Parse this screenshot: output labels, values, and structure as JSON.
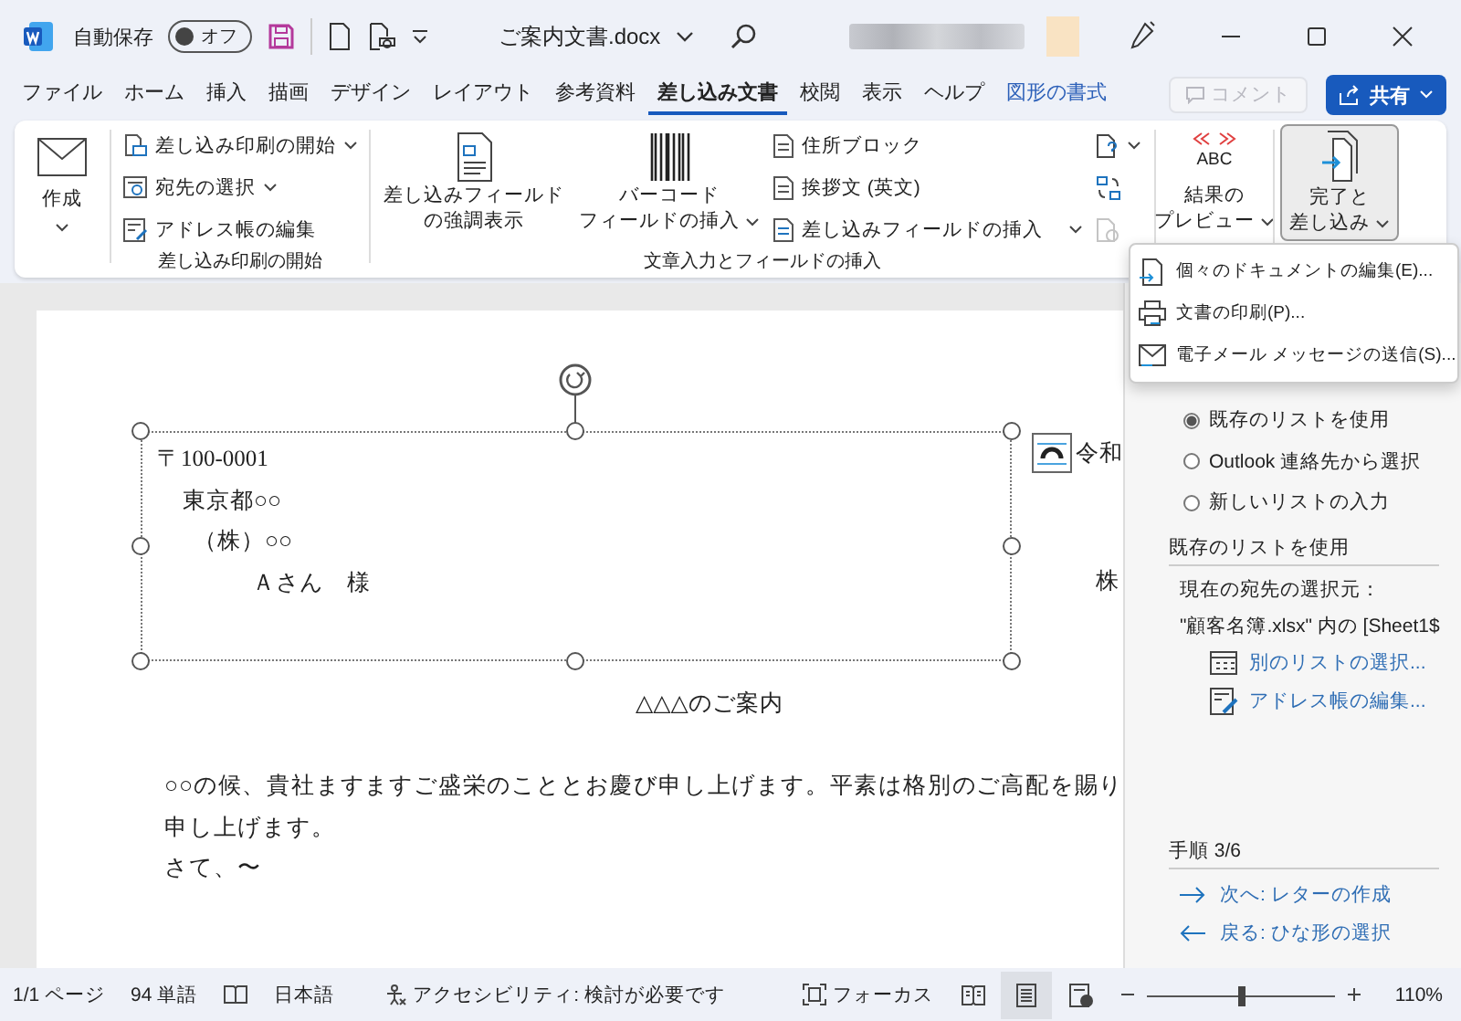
{
  "title_bar": {
    "autosave_label": "自動保存",
    "autosave": {
      "on": false,
      "label": "オフ"
    },
    "document_title": "ご案内文書.docx"
  },
  "menu_tabs": [
    {
      "label": "ファイル",
      "selected": false,
      "kind": "normal"
    },
    {
      "label": "ホーム",
      "selected": false,
      "kind": "normal"
    },
    {
      "label": "挿入",
      "selected": false,
      "kind": "normal"
    },
    {
      "label": "描画",
      "selected": false,
      "kind": "normal"
    },
    {
      "label": "デザイン",
      "selected": false,
      "kind": "normal"
    },
    {
      "label": "レイアウト",
      "selected": false,
      "kind": "normal"
    },
    {
      "label": "参考資料",
      "selected": false,
      "kind": "normal"
    },
    {
      "label": "差し込み文書",
      "selected": true,
      "kind": "normal"
    },
    {
      "label": "校閲",
      "selected": false,
      "kind": "normal"
    },
    {
      "label": "表示",
      "selected": false,
      "kind": "normal"
    },
    {
      "label": "ヘルプ",
      "selected": false,
      "kind": "normal"
    },
    {
      "label": "図形の書式",
      "selected": false,
      "kind": "contextual"
    }
  ],
  "comment_button": {
    "label": "コメント",
    "disabled": true
  },
  "share_button": {
    "label": "共有"
  },
  "ribbon": {
    "create": {
      "label": "作成",
      "dropdown": true
    },
    "start_group": {
      "items": [
        {
          "label": "差し込み印刷の開始",
          "dropdown": true
        },
        {
          "label": "宛先の選択",
          "dropdown": true
        },
        {
          "label": "アドレス帳の編集",
          "dropdown": false
        }
      ],
      "label": "差し込み印刷の開始"
    },
    "insert_group": {
      "large": [
        {
          "lines": [
            "差し込みフィールド",
            "の強調表示"
          ],
          "dropdown": false
        },
        {
          "lines": [
            "バーコード",
            "フィールドの挿入"
          ],
          "dropdown": true
        }
      ],
      "items": [
        {
          "label": "住所ブロック",
          "dropdown": false
        },
        {
          "label": "挨拶文 (英文)",
          "dropdown": false
        },
        {
          "label": "差し込みフィールドの挿入",
          "dropdown": true
        }
      ],
      "icon_buttons": [
        {
          "disabled": false,
          "dropdown": true
        },
        {
          "disabled": false,
          "dropdown": false
        },
        {
          "disabled": true,
          "dropdown": false
        }
      ],
      "label": "文章入力とフィールドの挿入"
    },
    "preview_group": {
      "icon_text": "ABC",
      "lines": [
        "結果の",
        "プレビュー"
      ],
      "dropdown": true
    },
    "finish_group": {
      "lines": [
        "完了と",
        "差し込み"
      ],
      "dropdown": true,
      "expanded": true
    }
  },
  "finish_menu": {
    "items": [
      {
        "label": "個々のドキュメントの編集(E)..."
      },
      {
        "label": "文書の印刷(P)..."
      },
      {
        "label": "電子メール メッセージの送信(S)..."
      }
    ]
  },
  "document": {
    "address_lines": [
      "〒100-0001",
      "東京都○○",
      "（株）○○",
      "Ａさん　様"
    ],
    "date_fragment": "令和",
    "right_fragment": "株",
    "heading": "△△△のご案内",
    "body_lines": [
      "○○の候、貴社ますますご盛栄のこととお慶び申し上げます。平素は格別のご高配を賜り",
      "申し上げます。"
    ],
    "closing_line": "さて、〜"
  },
  "task_pane": {
    "recipient_options": [
      {
        "label": "既存のリストを使用",
        "selected": true
      },
      {
        "label": "Outlook 連絡先から選択",
        "selected": false
      },
      {
        "label": "新しいリストの入力",
        "selected": false
      }
    ],
    "section_title": "既存のリストを使用",
    "source_label": "現在の宛先の選択元：",
    "source_value": "\"顧客名簿.xlsx\" 内の [Sheet1$",
    "links": [
      {
        "label": "別のリストの選択..."
      },
      {
        "label": "アドレス帳の編集..."
      }
    ],
    "step": "手順 3/6",
    "next": "次へ: レターの作成",
    "back": "戻る: ひな形の選択"
  },
  "status_bar": {
    "page": "1/1 ページ",
    "words": "94 単語",
    "language": "日本語",
    "accessibility": "アクセシビリティ: 検討が必要です",
    "focus": "フォーカス",
    "views": [
      {
        "selected": false
      },
      {
        "selected": true
      },
      {
        "selected": false
      }
    ],
    "zoom": {
      "level": 0.5,
      "reading": "110%"
    }
  }
}
